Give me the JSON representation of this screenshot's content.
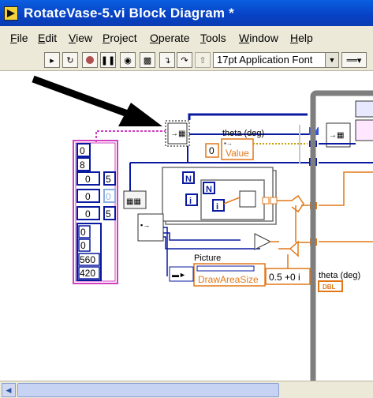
{
  "window": {
    "title": "RotateVase-5.vi Block Diagram *"
  },
  "menu": [
    {
      "label": "File",
      "ul": "F",
      "rest": "ile"
    },
    {
      "label": "Edit",
      "ul": "E",
      "rest": "dit"
    },
    {
      "label": "View",
      "ul": "V",
      "rest": "iew"
    },
    {
      "label": "Project",
      "ul": "P",
      "rest": "roject"
    },
    {
      "label": "Operate",
      "ul": "O",
      "rest": "perate"
    },
    {
      "label": "Tools",
      "ul": "T",
      "rest": "ools"
    },
    {
      "label": "Window",
      "ul": "W",
      "rest": "indow"
    },
    {
      "label": "Help",
      "ul": "H",
      "rest": "elp"
    }
  ],
  "toolbar": {
    "buttons": [
      "run-arrow-icon",
      "run-continuously-icon",
      "abort-icon",
      "pause-icon",
      "highlight-execution-icon",
      "retain-wire-values-icon",
      "step-into-icon",
      "step-over-icon",
      "step-out-icon"
    ],
    "font_select": "17pt Application Font",
    "align_label": "══▾"
  },
  "diagram": {
    "theta_label": "theta (deg)",
    "theta_const": "0",
    "value_prop": "Value",
    "picture_label": "Picture",
    "draw_area_prop": "DrawAreaSize",
    "complex_const": "0.5 +0 i",
    "theta_indicator_label": "theta (deg)",
    "dbl_label": "DBL",
    "cluster_values": [
      "0",
      "8",
      "0",
      "5",
      "0",
      "0",
      "0",
      "5",
      "0",
      "0",
      "560",
      "420"
    ],
    "loop_N": "N",
    "loop_i": "i"
  }
}
